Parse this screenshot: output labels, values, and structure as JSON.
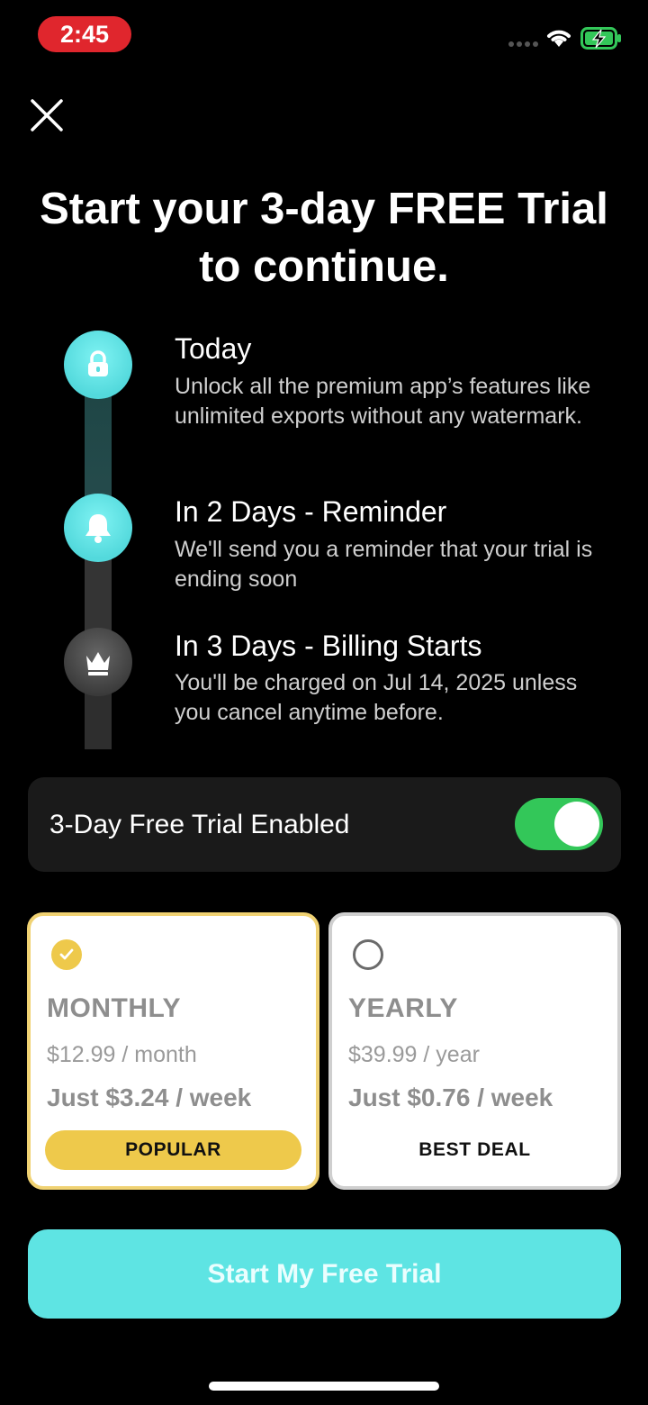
{
  "status_bar": {
    "time": "2:45",
    "icons": [
      "wifi-icon",
      "battery-charging-icon"
    ]
  },
  "headline": "Start your 3-day FREE Trial to continue.",
  "timeline": [
    {
      "title": "Today",
      "description": "Unlock all the premium app’s features like unlimited exports without any watermark.",
      "icon": "lock-icon"
    },
    {
      "title": "In 2 Days - Reminder",
      "description": "We'll send you a reminder that your trial is ending soon",
      "icon": "bell-icon"
    },
    {
      "title": "In 3 Days - Billing Starts",
      "description": "You'll be charged on Jul 14, 2025 unless you cancel anytime before.",
      "icon": "crown-icon"
    }
  ],
  "trial_toggle": {
    "label": "3-Day Free Trial Enabled",
    "enabled": true
  },
  "plans": [
    {
      "name": "MONTHLY",
      "price": "$12.99 / month",
      "weekly": "Just $3.24 / week",
      "badge": "POPULAR",
      "selected": true
    },
    {
      "name": "YEARLY",
      "price": "$39.99 / year",
      "weekly": "Just $0.76 / week",
      "badge": "BEST DEAL",
      "selected": false
    }
  ],
  "cta_label": "Start My Free Trial",
  "colors": {
    "accent": "#5ee4e3",
    "gold": "#eec94b",
    "toggle_on": "#33c759",
    "status_pill": "#e0262d"
  }
}
